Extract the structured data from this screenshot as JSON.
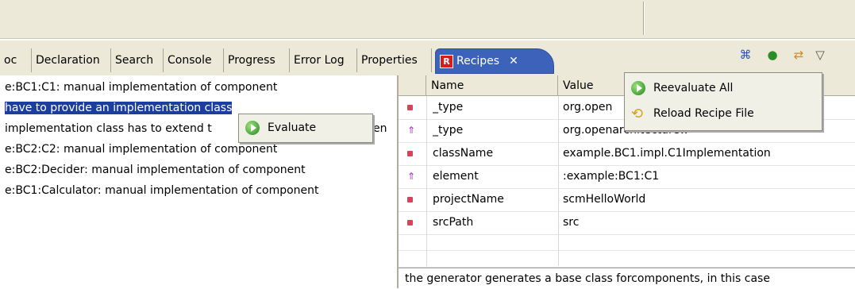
{
  "tabs": [
    {
      "label": "oc"
    },
    {
      "label": "Declaration"
    },
    {
      "label": "Search"
    },
    {
      "label": "Console"
    },
    {
      "label": "Progress"
    },
    {
      "label": "Error Log"
    },
    {
      "label": "Properties"
    },
    {
      "label": "Recipes",
      "icon": "R",
      "close": "✕"
    }
  ],
  "toolbar": {
    "icons": [
      "collapse-icon",
      "run-icon",
      "sync-icon",
      "menu-chevron-icon"
    ]
  },
  "left_lines": [
    "e:BC1:C1: manual implementation of component",
    "have to provide an implementation class",
    "implementation class has to extend t",
    "e:BC2:C2: manual implementation of component",
    "e:BC2:Decider: manual implementation of component",
    "e:BC1:Calculator: manual implementation of component"
  ],
  "left_overflow_fragment": "en",
  "evaluate_popup": {
    "label": "Evaluate"
  },
  "properties": {
    "headers": [
      "Name",
      "Value"
    ],
    "rows": [
      {
        "name": "_type",
        "value": "org.open",
        "marker": "square"
      },
      {
        "name": "_type",
        "value": "org.openarchitectureware.eclipse.",
        "marker": "arrow"
      },
      {
        "name": "className",
        "value": "example.BC1.impl.C1Implementation",
        "marker": "square"
      },
      {
        "name": "element",
        "value": ":example:BC1:C1",
        "marker": "arrow"
      },
      {
        "name": "projectName",
        "value": "scmHelloWorld",
        "marker": "square"
      },
      {
        "name": "srcPath",
        "value": "src",
        "marker": "square"
      }
    ],
    "description": "the generator generates a base class forcomponents, in this case"
  },
  "context_menu": {
    "items": [
      {
        "label": "Reevaluate All",
        "icon": "run-icon"
      },
      {
        "label": "Reload Recipe File",
        "icon": "reload-icon"
      }
    ]
  },
  "colors": {
    "selection": "#1c3e9c",
    "active_tab": "#3c63b9",
    "marker": "#d9435a"
  }
}
